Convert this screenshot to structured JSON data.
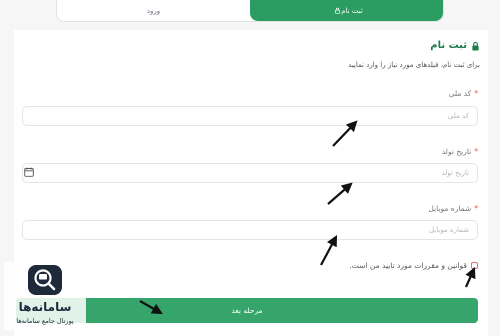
{
  "tabs": {
    "login_label": "ورود",
    "register_label": "ثبت نام"
  },
  "form": {
    "title": "ثبت نام",
    "subtitle": "برای ثبت نام، فیلدهای مورد نیاز را وارد نمایید",
    "fields": [
      {
        "label": "کد ملی",
        "placeholder": "کد ملی",
        "value": ""
      },
      {
        "label": "تاریخ تولد",
        "placeholder": "تاریخ تولد",
        "value": ""
      },
      {
        "label": "شماره موبایل",
        "placeholder": "شماره موبایل",
        "value": ""
      }
    ],
    "terms_label": "قوانین و مقررات مورد تایید من است.",
    "terms_checked": false,
    "submit_label": "مرحله بعد"
  },
  "watermark": {
    "name": "سامانه‌ها",
    "tagline": "پورتال جامع سامانه‌ها"
  },
  "colors": {
    "accent": "#2b9d62",
    "button": "#35a56b",
    "title": "#1f7a4a",
    "required": "#e55353"
  }
}
